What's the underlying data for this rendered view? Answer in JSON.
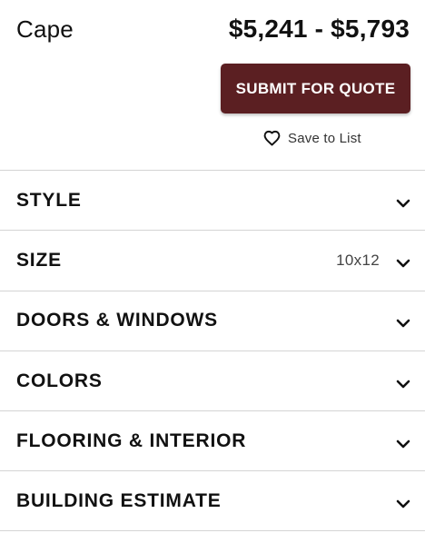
{
  "product": {
    "title": "Cape",
    "price_range": "$5,241 - $5,793"
  },
  "actions": {
    "submit_label": "SUBMIT FOR QUOTE",
    "save_label": "Save to List"
  },
  "icons": {
    "save": "heart-outline-icon",
    "expand": "chevron-down-icon"
  },
  "colors": {
    "primary_button": "#5b1f22",
    "divider": "#d4d4d4"
  },
  "sections": [
    {
      "label": "STYLE",
      "value": ""
    },
    {
      "label": "SIZE",
      "value": "10x12"
    },
    {
      "label": "DOORS & WINDOWS",
      "value": ""
    },
    {
      "label": "COLORS",
      "value": ""
    },
    {
      "label": "FLOORING & INTERIOR",
      "value": ""
    },
    {
      "label": "BUILDING ESTIMATE",
      "value": ""
    }
  ]
}
